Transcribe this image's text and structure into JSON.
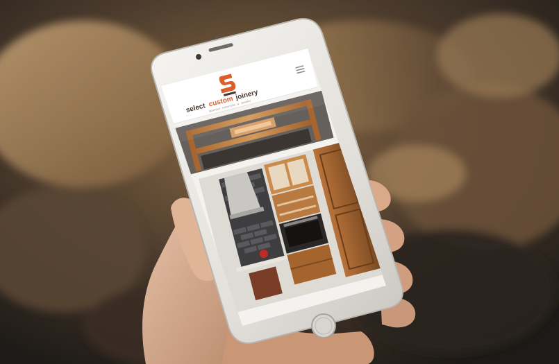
{
  "website": {
    "logo": {
      "word_select": "select",
      "word_custom": "custom",
      "word_joinery": "joinery",
      "tagline": "BESPOKE · FURNITURE · & · JOINERY",
      "icon": "s-monogram-icon"
    },
    "menu_icon": "hamburger-menu-icon"
  },
  "colors": {
    "brand_orange": "#d9541e",
    "brand_dark": "#3b2a24",
    "wood": "#c98a4a",
    "phone_body": "#e9e7e3"
  }
}
